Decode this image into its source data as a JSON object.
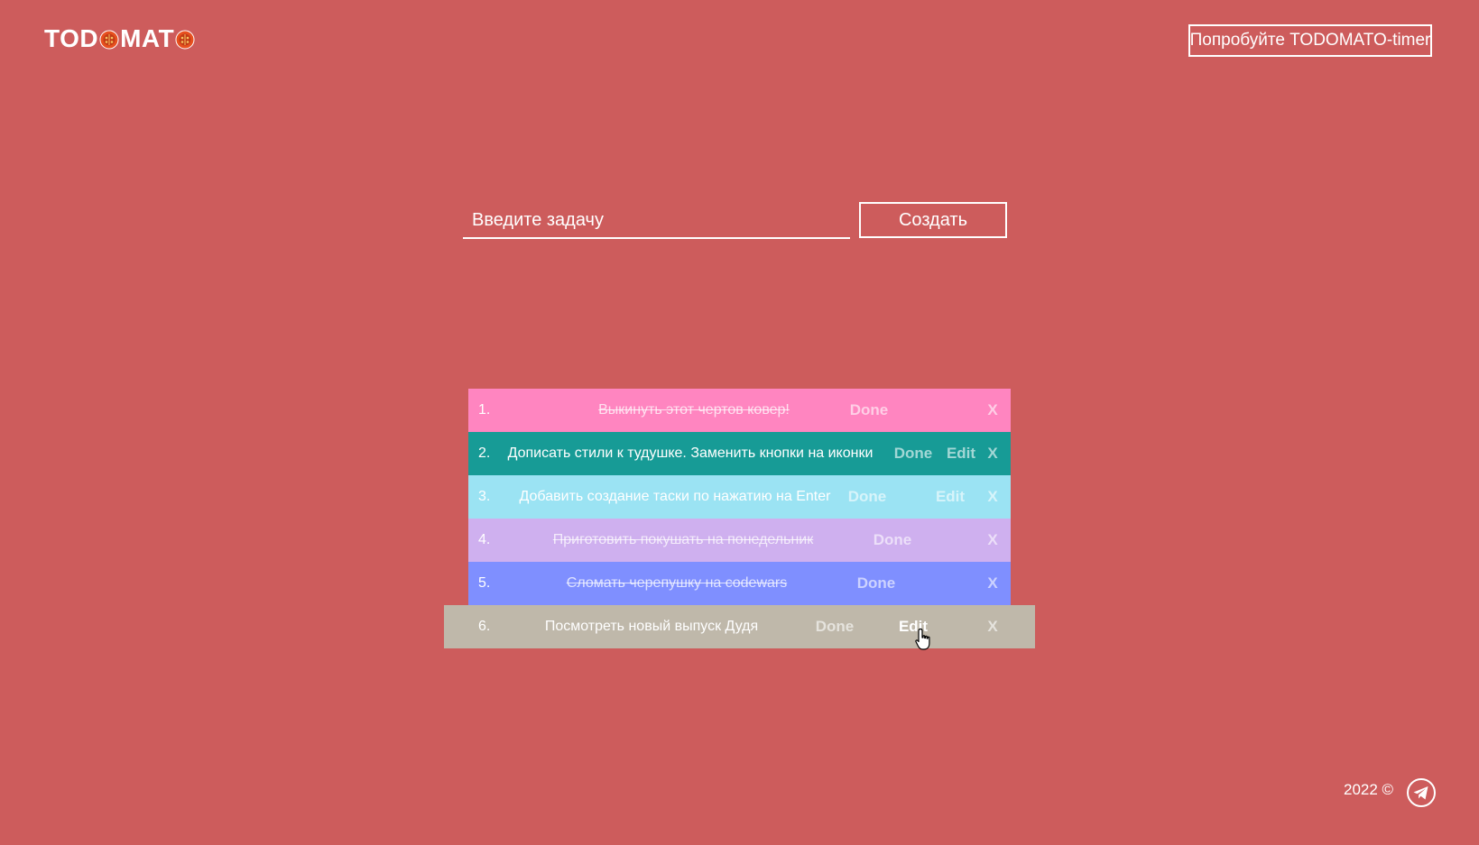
{
  "header": {
    "logo_part1": "TOD",
    "logo_part2": "MAT",
    "try_button_label": "Попробуйте TODOMATO-timer"
  },
  "form": {
    "input_placeholder": "Введите задачу",
    "input_value": "",
    "create_label": "Создать"
  },
  "tasks": [
    {
      "num": "1.",
      "text": "Выкинуть этот чертов ковер!",
      "done_label": "Done",
      "edit_label": "",
      "delete_label": "X",
      "completed": true,
      "bg": "#ff85c0"
    },
    {
      "num": "2.",
      "text": "Дописать стили к тудушке. Заменить кнопки на иконки",
      "done_label": "Done",
      "edit_label": "Edit",
      "delete_label": "X",
      "completed": false,
      "bg": "#179b96"
    },
    {
      "num": "3.",
      "text": "Добавить создание таски по нажатию на Enter",
      "done_label": "Done",
      "edit_label": "Edit",
      "delete_label": "X",
      "completed": false,
      "bg": "#9be3f3"
    },
    {
      "num": "4.",
      "text": "Приготовить покушать на понедельник",
      "done_label": "Done",
      "edit_label": "",
      "delete_label": "X",
      "completed": true,
      "bg": "#cfb0ef"
    },
    {
      "num": "5.",
      "text": "Сломать черепушку на codewars",
      "done_label": "Done",
      "edit_label": "",
      "delete_label": "X",
      "completed": true,
      "bg": "#7f8fff"
    },
    {
      "num": "6.",
      "text": "Посмотреть новый выпуск Дудя",
      "done_label": "Done",
      "edit_label": "Edit",
      "delete_label": "X",
      "completed": false,
      "bg": "#bfb8aa"
    }
  ],
  "footer": {
    "copyright": "2022 ©",
    "telegram_icon": "telegram-icon"
  },
  "colors": {
    "background": "#cd5c5c",
    "text": "#ffffff"
  }
}
